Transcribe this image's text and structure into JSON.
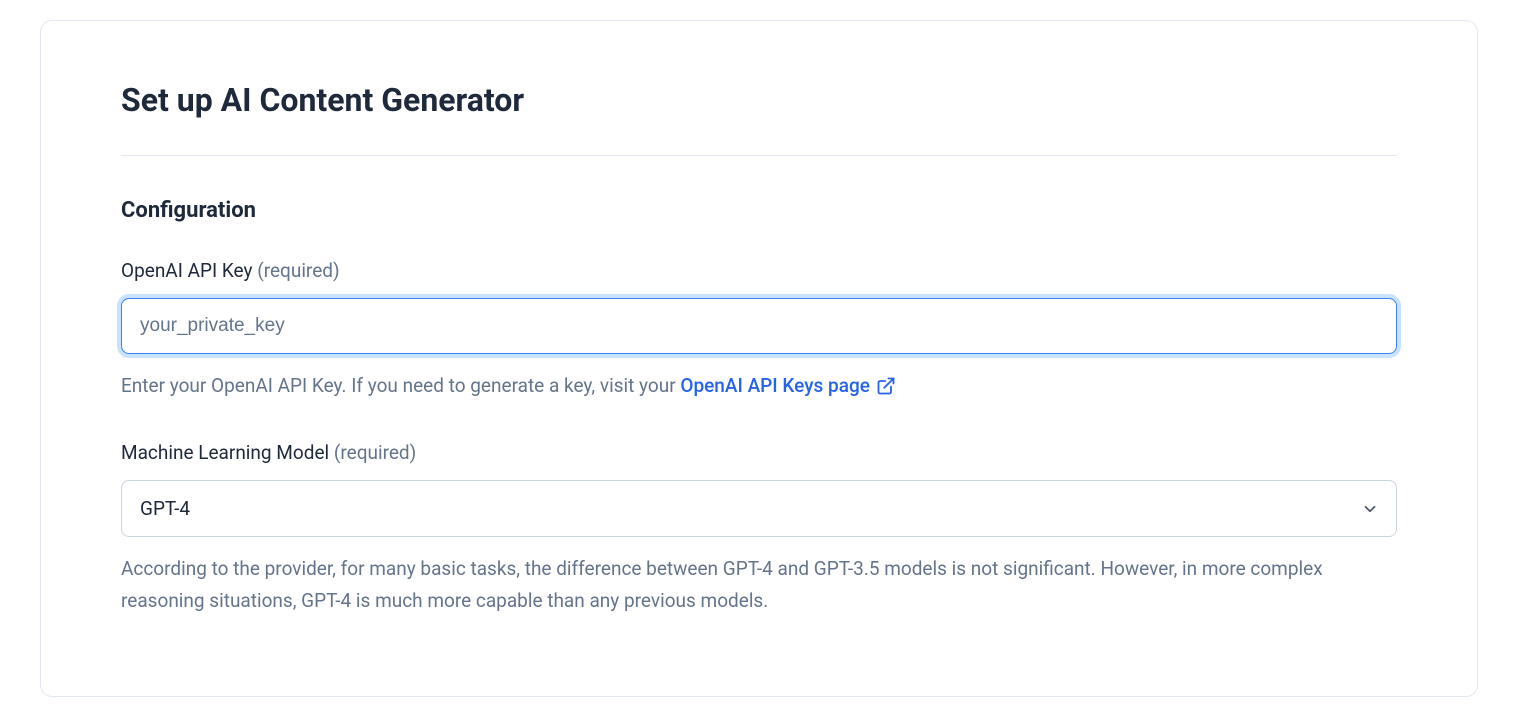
{
  "header": {
    "title": "Set up AI Content Generator"
  },
  "section": {
    "title": "Configuration"
  },
  "fields": {
    "apiKey": {
      "label": "OpenAI API Key",
      "required_text": "(required)",
      "placeholder": "your_private_key",
      "value": "",
      "helper_prefix": "Enter your OpenAI API Key. If you need to generate a key, visit your ",
      "helper_link_text": "OpenAI API Keys page"
    },
    "model": {
      "label": "Machine Learning Model",
      "required_text": "(required)",
      "selected": "GPT-4",
      "helper": "According to the provider, for many basic tasks, the difference between GPT-4 and GPT-3.5 models is not significant. However, in more complex reasoning situations, GPT-4 is much more capable than any previous models."
    }
  }
}
